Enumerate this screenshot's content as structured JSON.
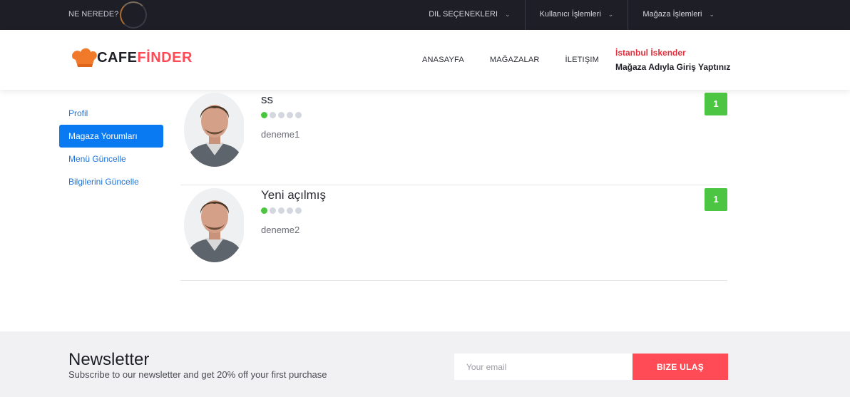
{
  "topbar": {
    "brand": "NE NEREDE?",
    "menus": [
      {
        "label": "DIL SEÇENEKLERI"
      },
      {
        "label": "Kullanıcı İşlemleri"
      },
      {
        "label": "Mağaza İşlemleri"
      }
    ]
  },
  "header": {
    "logo": {
      "part1": "CAFE",
      "part2": "FİNDER"
    },
    "nav": [
      "ANASAYFA",
      "MAĞAZALAR",
      "İLETIŞIM"
    ],
    "user": {
      "name": "İstanbul İskender",
      "status": "Mağaza Adıyla Giriş Yaptınız"
    }
  },
  "sidebar": {
    "items": [
      {
        "label": "Profil",
        "active": false
      },
      {
        "label": "Magaza Yorumları",
        "active": true
      },
      {
        "label": "Menü Güncelle",
        "active": false
      },
      {
        "label": "Bilgilerini Güncelle",
        "active": false
      }
    ]
  },
  "reviews": [
    {
      "title": "ss",
      "rating": 1,
      "max_rating": 5,
      "text": "deneme1",
      "score": "1"
    },
    {
      "title": "Yeni açılmış",
      "rating": 1,
      "max_rating": 5,
      "text": "deneme2",
      "score": "1"
    }
  ],
  "footer": {
    "title": "Newsletter",
    "subtitle": "Subscribe to our newsletter and get 20% off your first purchase",
    "email_placeholder": "Your email",
    "button": "BIZE ULAŞ"
  },
  "colors": {
    "accent": "#ff4b55",
    "primary": "#0a7af2",
    "success": "#4cc542",
    "dark": "#1e1f26"
  }
}
